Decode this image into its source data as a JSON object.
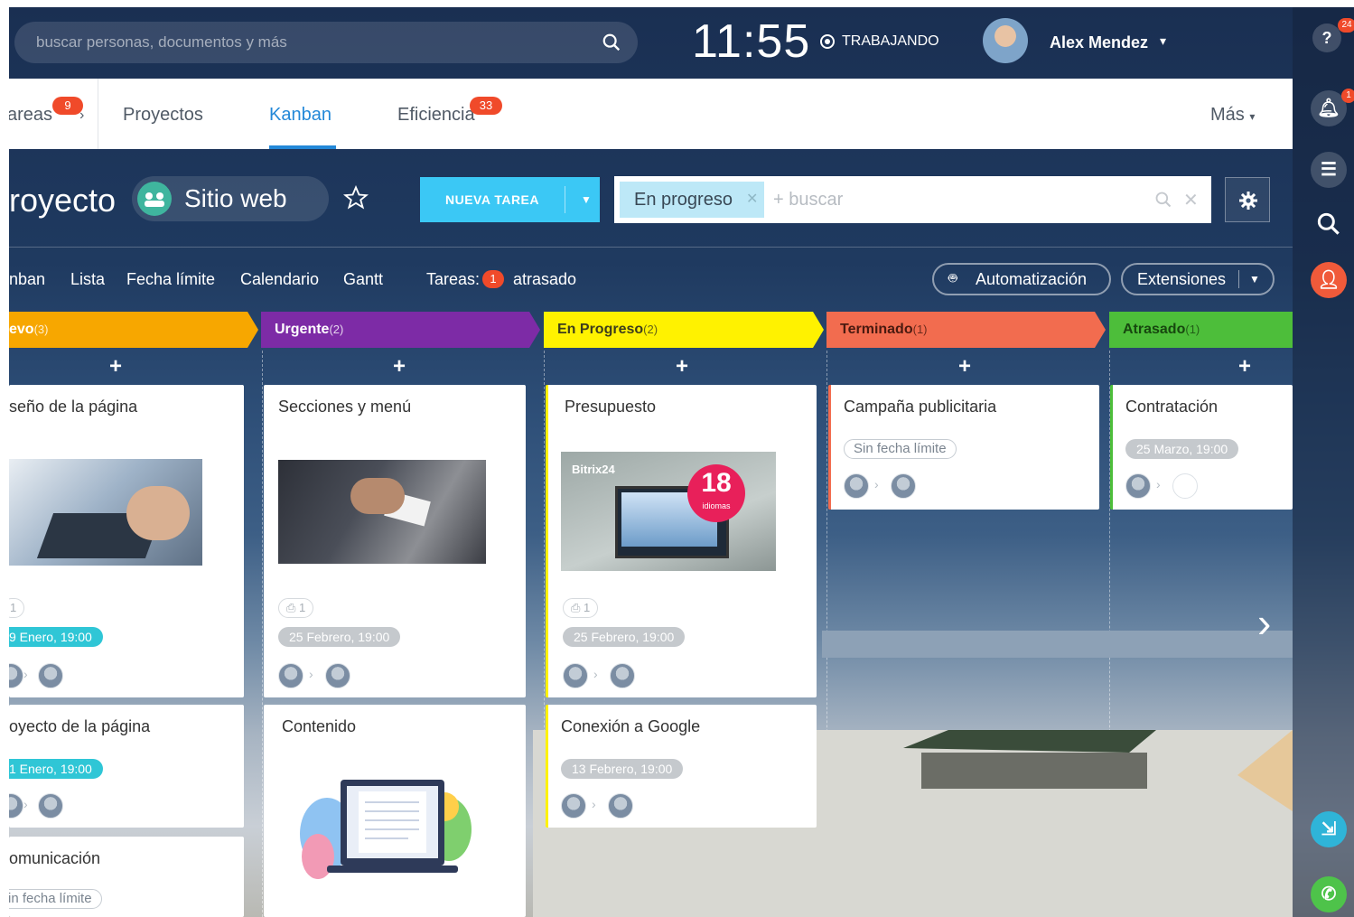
{
  "search": {
    "placeholder": "buscar personas, documentos y más"
  },
  "clock": {
    "time": "11:55",
    "status": "TRABAJANDO"
  },
  "user": {
    "name": "Alex Mendez"
  },
  "nav": {
    "tareas": {
      "label": "Tareas",
      "badge": "9"
    },
    "proyectos": {
      "label": "Proyectos"
    },
    "kanban": {
      "label": "Kanban"
    },
    "eficiencia": {
      "label": "Eficiencia",
      "badge": "33"
    },
    "more": {
      "label": "Más"
    }
  },
  "project": {
    "title": "royecto",
    "name": "Sitio web"
  },
  "toolbar": {
    "new_task": "NUEVA TAREA",
    "filter_chip": "En progreso",
    "filter_placeholder": "+ buscar"
  },
  "views": {
    "kanban": "nban",
    "list": "Lista",
    "deadline": "Fecha límite",
    "calendar": "Calendario",
    "gantt": "Gantt",
    "tasks_label": "Tareas:",
    "overdue_count": "1",
    "overdue_label": "atrasado",
    "automation": "Automatización",
    "extensions": "Extensiones"
  },
  "columns": [
    {
      "name": "evo",
      "count": "(3)",
      "color": "#f7a700"
    },
    {
      "name": "Urgente",
      "count": "(2)",
      "color": "#7d2ba6"
    },
    {
      "name": "En Progreso",
      "count": "(2)",
      "color": "#fff200"
    },
    {
      "name": "Terminado",
      "count": "(1)",
      "color": "#f26c4f"
    },
    {
      "name": "Atrasado",
      "count": "(1)",
      "color": "#4dbe3a"
    }
  ],
  "cards": {
    "c0a": {
      "title": "seño de la página",
      "count": "1",
      "date": "9 Enero, 19:00"
    },
    "c0b": {
      "title": "oyecto de la página",
      "date": "1 Enero, 19:00"
    },
    "c0c": {
      "title": "omunicación",
      "nodate": "in fecha límite"
    },
    "c1a": {
      "title": "Secciones y menú",
      "count": "1",
      "date": "25 Febrero, 19:00"
    },
    "c1b": {
      "title": "Contenido"
    },
    "c2a": {
      "title": "Presupuesto",
      "count": "1",
      "date": "25 Febrero, 19:00",
      "thumb_brand": "Bitrix24",
      "thumb_number": "18",
      "thumb_sub": "idiomas"
    },
    "c2b": {
      "title": "Conexión a Google",
      "date": "13 Febrero, 19:00"
    },
    "c3a": {
      "title": "Campaña publicitaria",
      "nodate": "Sin fecha límite"
    },
    "c4a": {
      "title": "Contratación",
      "date": "25 Marzo, 19:00"
    }
  },
  "sidebar": {
    "help_badge": "24",
    "bell_badge": "1"
  },
  "colors": {
    "accent": "#2388d8",
    "new_task_button": "#3bc8f5",
    "badge": "#f04a2a",
    "date_teal": "#2fc6d6",
    "date_gray": "#c5c9cd"
  }
}
